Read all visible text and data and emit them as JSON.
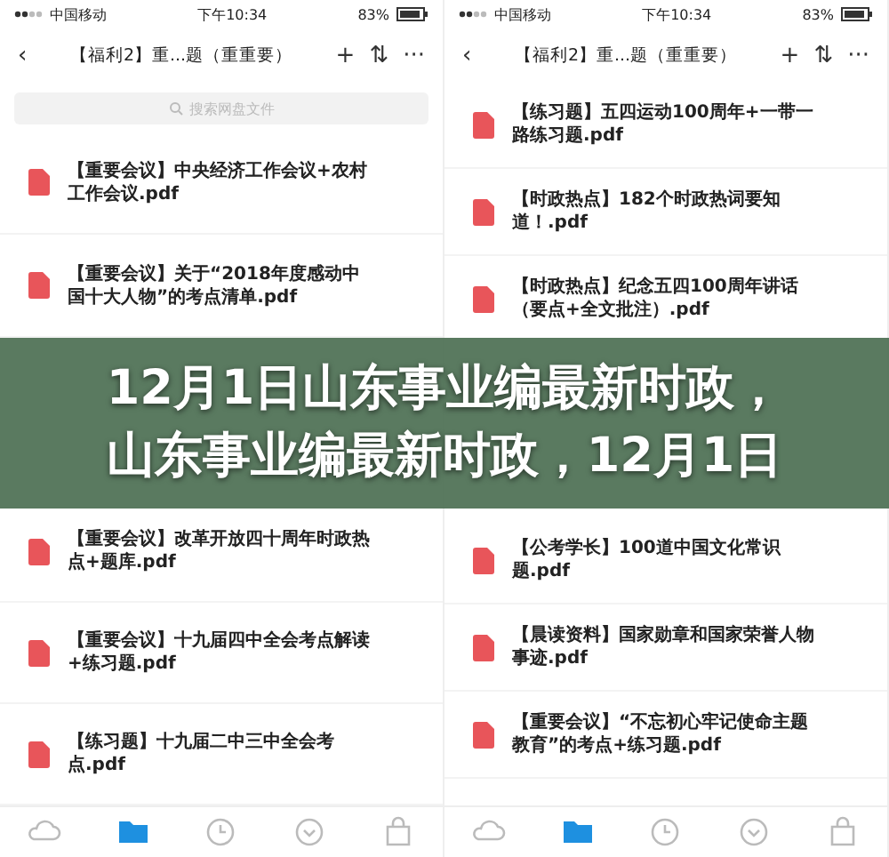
{
  "panels": [
    {
      "status_bar": {
        "carrier": "中国移动",
        "time": "下午10:34",
        "battery": "83%"
      },
      "nav": {
        "back": "‹",
        "title": "【福利2】重...题（重重要）",
        "add": "+",
        "sort": "⇅",
        "more": "···"
      },
      "search": {
        "placeholder": "搜索网盘文件"
      },
      "top_files": [
        {
          "title": "【重要会议】中央经济工作会议+农村工作会议.pdf"
        },
        {
          "title": "【重要会议】关于“2018年度感动中国十大人物”的考点清单.pdf"
        }
      ],
      "bottom_files": [
        {
          "title": "【重要会议】改革开放四十周年时政热点+题库.pdf"
        },
        {
          "title": "【重要会议】十九届四中全会考点解读+练习题.pdf"
        },
        {
          "title": "【练习题】十九届二中三中全会考点.pdf"
        }
      ],
      "tab_bar": [
        {
          "selected": false
        },
        {
          "selected": true
        },
        {
          "selected": false
        },
        {
          "selected": false
        },
        {
          "selected": false
        }
      ]
    },
    {
      "status_bar": {
        "carrier": "中国移动",
        "time": "下午10:34",
        "battery": "83%"
      },
      "nav": {
        "back": "‹",
        "title": "【福利2】重...题（重重要）",
        "add": "+",
        "sort": "⇅",
        "more": "···"
      },
      "top_files": [
        {
          "title": "【练习题】五四运动100周年+一带一路练习题.pdf"
        },
        {
          "title": "【时政热点】182个时政热词要知道！.pdf"
        },
        {
          "title": "【时政热点】纪念五四100周年讲话（要点+全文批注）.pdf"
        }
      ],
      "bottom_files": [
        {
          "title": "【公考学长】100道中国文化常识题.pdf"
        },
        {
          "title": "【晨读资料】国家勋章和国家荣誉人物事迹.pdf"
        },
        {
          "title": "【重要会议】“不忘初心牢记使命主题教育”的考点+练习题.pdf"
        }
      ],
      "tab_bar": [
        {
          "selected": false
        },
        {
          "selected": true
        },
        {
          "selected": false
        },
        {
          "selected": false
        },
        {
          "selected": false
        }
      ]
    }
  ],
  "banner": {
    "lines": [
      "12月1日山东事业编最新时政，",
      "山东事业编最新时政，12月1日"
    ]
  }
}
